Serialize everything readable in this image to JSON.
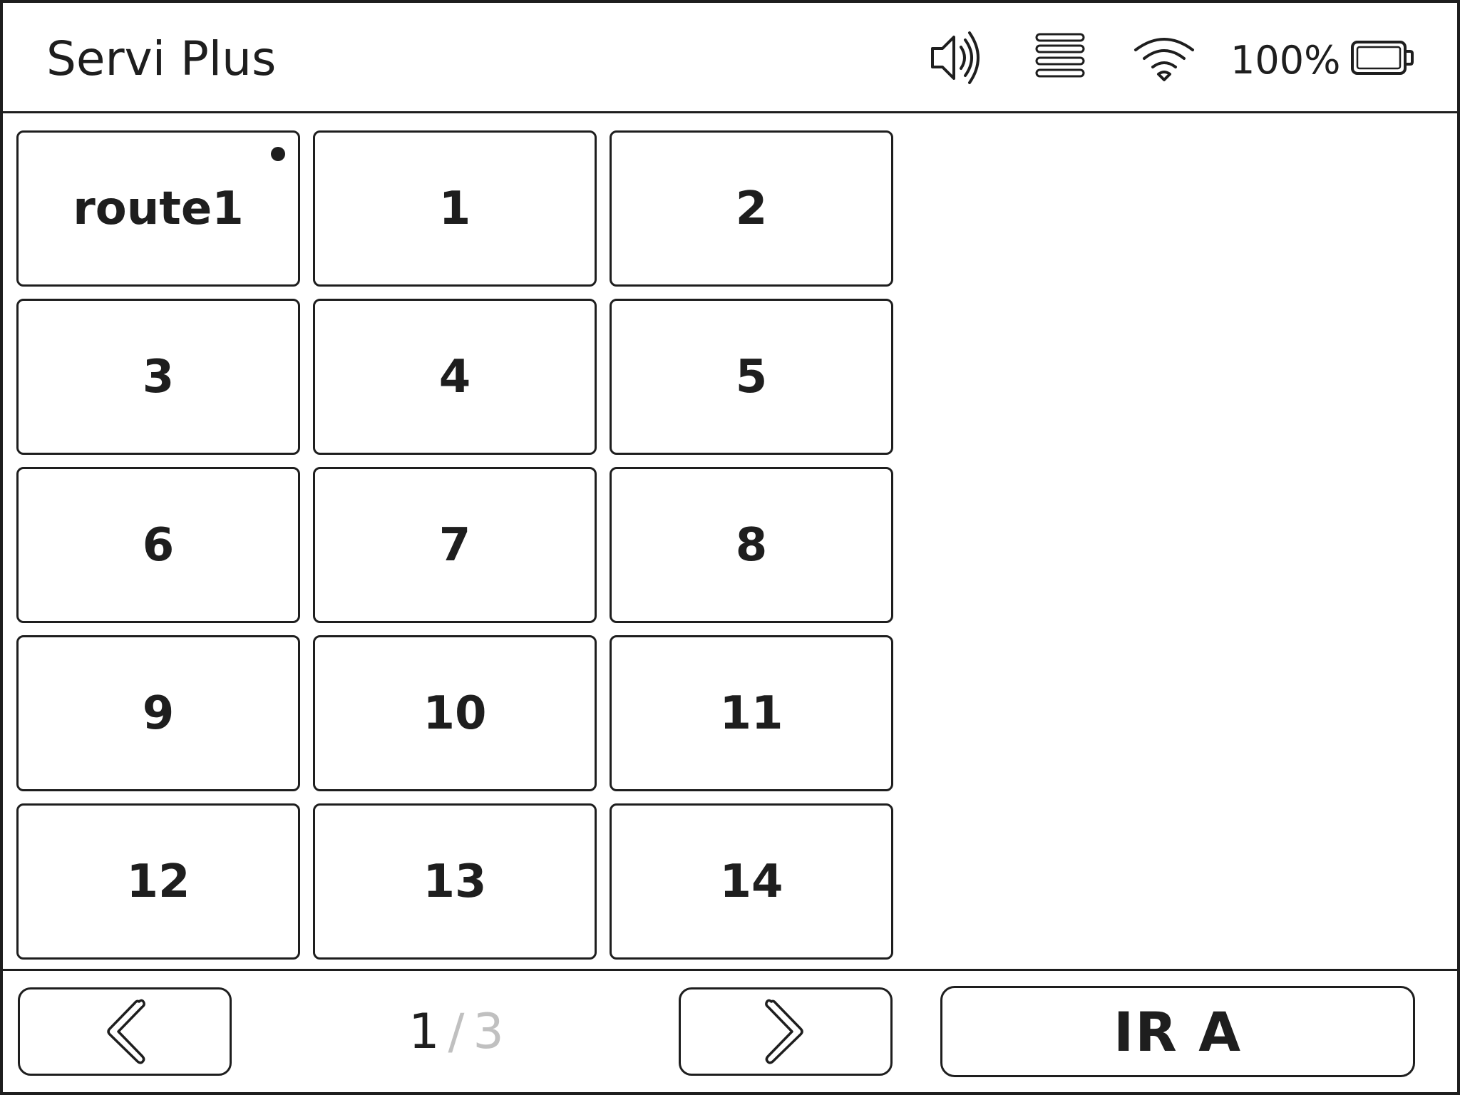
{
  "header": {
    "title": "Servi Plus",
    "icons": [
      "speaker-icon",
      "menu-icon",
      "wifi-icon",
      "battery-icon"
    ],
    "battery_percent": "100%"
  },
  "tiles": [
    {
      "label": "route1",
      "selected": true
    },
    {
      "label": "1"
    },
    {
      "label": "2"
    },
    {
      "label": "3"
    },
    {
      "label": "4"
    },
    {
      "label": "5"
    },
    {
      "label": "6"
    },
    {
      "label": "7"
    },
    {
      "label": "8"
    },
    {
      "label": "9"
    },
    {
      "label": "10"
    },
    {
      "label": "11"
    },
    {
      "label": "12"
    },
    {
      "label": "13"
    },
    {
      "label": "14"
    }
  ],
  "pagination": {
    "current": "1",
    "separator": "/",
    "total": "3",
    "prev_icon": "chevron-left-icon",
    "next_icon": "chevron-right-icon"
  },
  "go_button": {
    "label": "IR A"
  },
  "colors": {
    "ink": "#1e1e1e",
    "muted": "#c0c0c0",
    "background": "#ffffff"
  }
}
